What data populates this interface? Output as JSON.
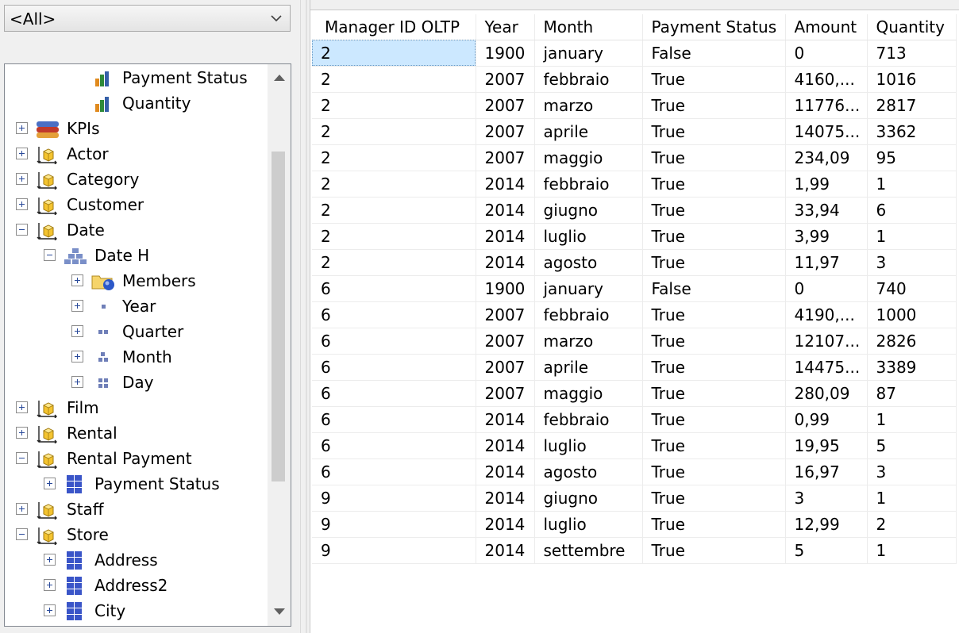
{
  "filter": {
    "selected": "<All>"
  },
  "tree": [
    {
      "indent": 3,
      "icon": "measure-bar-icon",
      "label": "Payment Status",
      "expander": "none"
    },
    {
      "indent": 3,
      "icon": "measure-bar-icon",
      "label": "Quantity",
      "expander": "none"
    },
    {
      "indent": 1,
      "icon": "kpi-icon",
      "label": "KPIs",
      "expander": "plus"
    },
    {
      "indent": 1,
      "icon": "dimension-cube-icon",
      "label": "Actor",
      "expander": "plus"
    },
    {
      "indent": 1,
      "icon": "dimension-cube-icon",
      "label": "Category",
      "expander": "plus"
    },
    {
      "indent": 1,
      "icon": "dimension-cube-icon",
      "label": "Customer",
      "expander": "plus"
    },
    {
      "indent": 1,
      "icon": "dimension-cube-icon",
      "label": "Date",
      "expander": "minus"
    },
    {
      "indent": 2,
      "icon": "hierarchy-icon",
      "label": "Date H",
      "expander": "minus"
    },
    {
      "indent": 3,
      "icon": "members-folder-icon",
      "label": "Members",
      "expander": "plus"
    },
    {
      "indent": 3,
      "icon": "level-1-icon",
      "label": "Year",
      "expander": "plus"
    },
    {
      "indent": 3,
      "icon": "level-2-icon",
      "label": "Quarter",
      "expander": "plus"
    },
    {
      "indent": 3,
      "icon": "level-3-icon",
      "label": "Month",
      "expander": "plus"
    },
    {
      "indent": 3,
      "icon": "level-4-icon",
      "label": "Day",
      "expander": "plus"
    },
    {
      "indent": 1,
      "icon": "dimension-cube-icon",
      "label": "Film",
      "expander": "plus"
    },
    {
      "indent": 1,
      "icon": "dimension-cube-icon",
      "label": "Rental",
      "expander": "plus"
    },
    {
      "indent": 1,
      "icon": "dimension-cube-icon",
      "label": "Rental Payment",
      "expander": "minus"
    },
    {
      "indent": 2,
      "icon": "attribute-grid-icon",
      "label": "Payment Status",
      "expander": "plus"
    },
    {
      "indent": 1,
      "icon": "dimension-cube-icon",
      "label": "Staff",
      "expander": "plus"
    },
    {
      "indent": 1,
      "icon": "dimension-cube-icon",
      "label": "Store",
      "expander": "minus"
    },
    {
      "indent": 2,
      "icon": "attribute-grid-icon",
      "label": "Address",
      "expander": "plus"
    },
    {
      "indent": 2,
      "icon": "attribute-grid-icon",
      "label": "Address2",
      "expander": "plus"
    },
    {
      "indent": 2,
      "icon": "attribute-grid-icon",
      "label": "City",
      "expander": "plus"
    }
  ],
  "results": {
    "columns": [
      "Manager ID OLTP",
      "Year",
      "Month",
      "Payment Status",
      "Amount",
      "Quantity"
    ],
    "rows": [
      [
        "2",
        "1900",
        "january",
        "False",
        "0",
        "713"
      ],
      [
        "2",
        "2007",
        "febbraio",
        "True",
        "4160,...",
        "1016"
      ],
      [
        "2",
        "2007",
        "marzo",
        "True",
        "11776...",
        "2817"
      ],
      [
        "2",
        "2007",
        "aprile",
        "True",
        "14075...",
        "3362"
      ],
      [
        "2",
        "2007",
        "maggio",
        "True",
        "234,09",
        "95"
      ],
      [
        "2",
        "2014",
        "febbraio",
        "True",
        "1,99",
        "1"
      ],
      [
        "2",
        "2014",
        "giugno",
        "True",
        "33,94",
        "6"
      ],
      [
        "2",
        "2014",
        "luglio",
        "True",
        "3,99",
        "1"
      ],
      [
        "2",
        "2014",
        "agosto",
        "True",
        "11,97",
        "3"
      ],
      [
        "6",
        "1900",
        "january",
        "False",
        "0",
        "740"
      ],
      [
        "6",
        "2007",
        "febbraio",
        "True",
        "4190,...",
        "1000"
      ],
      [
        "6",
        "2007",
        "marzo",
        "True",
        "12107...",
        "2826"
      ],
      [
        "6",
        "2007",
        "aprile",
        "True",
        "14475...",
        "3389"
      ],
      [
        "6",
        "2007",
        "maggio",
        "True",
        "280,09",
        "87"
      ],
      [
        "6",
        "2014",
        "febbraio",
        "True",
        "0,99",
        "1"
      ],
      [
        "6",
        "2014",
        "luglio",
        "True",
        "19,95",
        "5"
      ],
      [
        "6",
        "2014",
        "agosto",
        "True",
        "16,97",
        "3"
      ],
      [
        "9",
        "2014",
        "giugno",
        "True",
        "3",
        "1"
      ],
      [
        "9",
        "2014",
        "luglio",
        "True",
        "12,99",
        "2"
      ],
      [
        "9",
        "2014",
        "settembre",
        "True",
        "5",
        "1"
      ]
    ]
  },
  "colors": {
    "selection": "#cce8ff",
    "grid_line": "#ececec",
    "tree_border": "#828790"
  }
}
